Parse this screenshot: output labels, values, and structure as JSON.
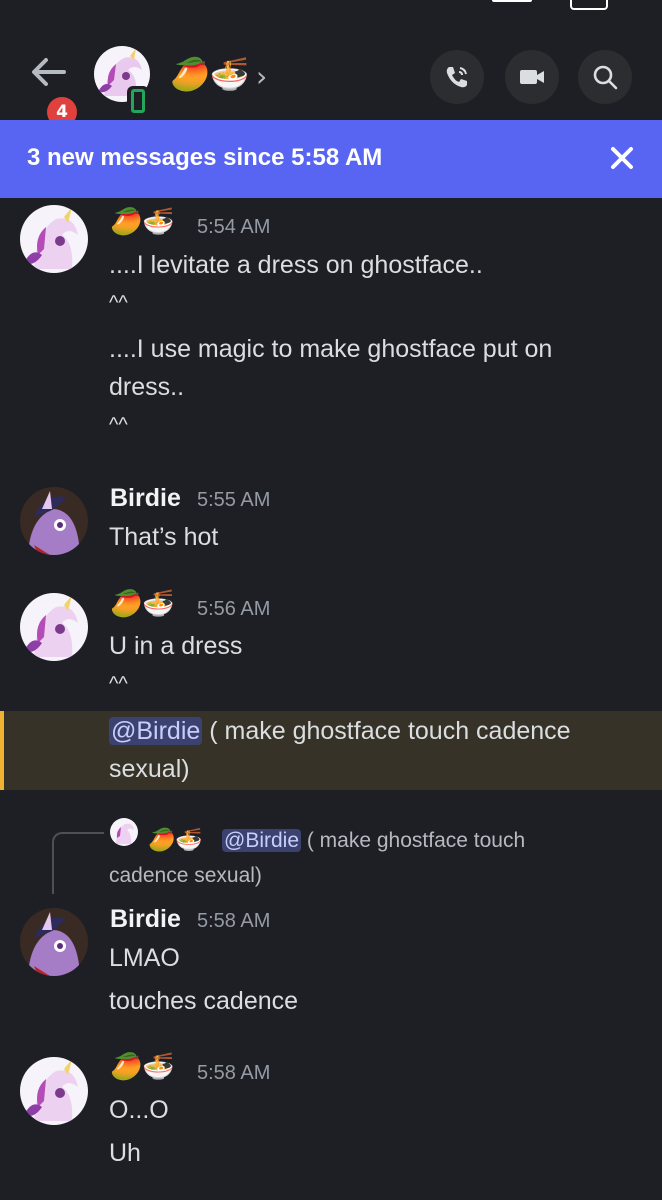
{
  "header": {
    "back_badge": "4",
    "recipient_name": "🥭🍜"
  },
  "banner": {
    "text": "3 new messages since 5:58 AM"
  },
  "messages": [
    {
      "author": "🥭🍜",
      "time": "5:54 AM",
      "lines": [
        "....I levitate  a dress on ghostface..",
        "^^",
        "....I use magic to make ghostface  put on",
        "dress..",
        "^^"
      ]
    },
    {
      "author": "Birdie",
      "time": "5:55 AM",
      "lines": [
        "That’s hot"
      ]
    },
    {
      "author": "🥭🍜",
      "time": "5:56 AM",
      "lines": [
        "U in a dress",
        "^^"
      ]
    },
    {
      "mention": "@Birdie",
      "text_after_mention": " ( make ghostface  touch cadence",
      "continuation": "sexual)"
    },
    {
      "reply": {
        "author": "🥭🍜",
        "mention": "@Birdie",
        "text": " ( make ghostface  touch",
        "continuation": "cadence  sexual)"
      },
      "author": "Birdie",
      "time": "5:58 AM",
      "lines": [
        "LMAO",
        "touches cadence"
      ]
    },
    {
      "author": "🥭🍜",
      "time": "5:58 AM",
      "lines": [
        "O...O",
        "Uh"
      ]
    }
  ],
  "colors": {
    "background": "#1e1f24",
    "banner": "#5865f2",
    "mention_highlight": "#373227",
    "mention_bar": "#f0b232",
    "badge": "#e0413c"
  }
}
